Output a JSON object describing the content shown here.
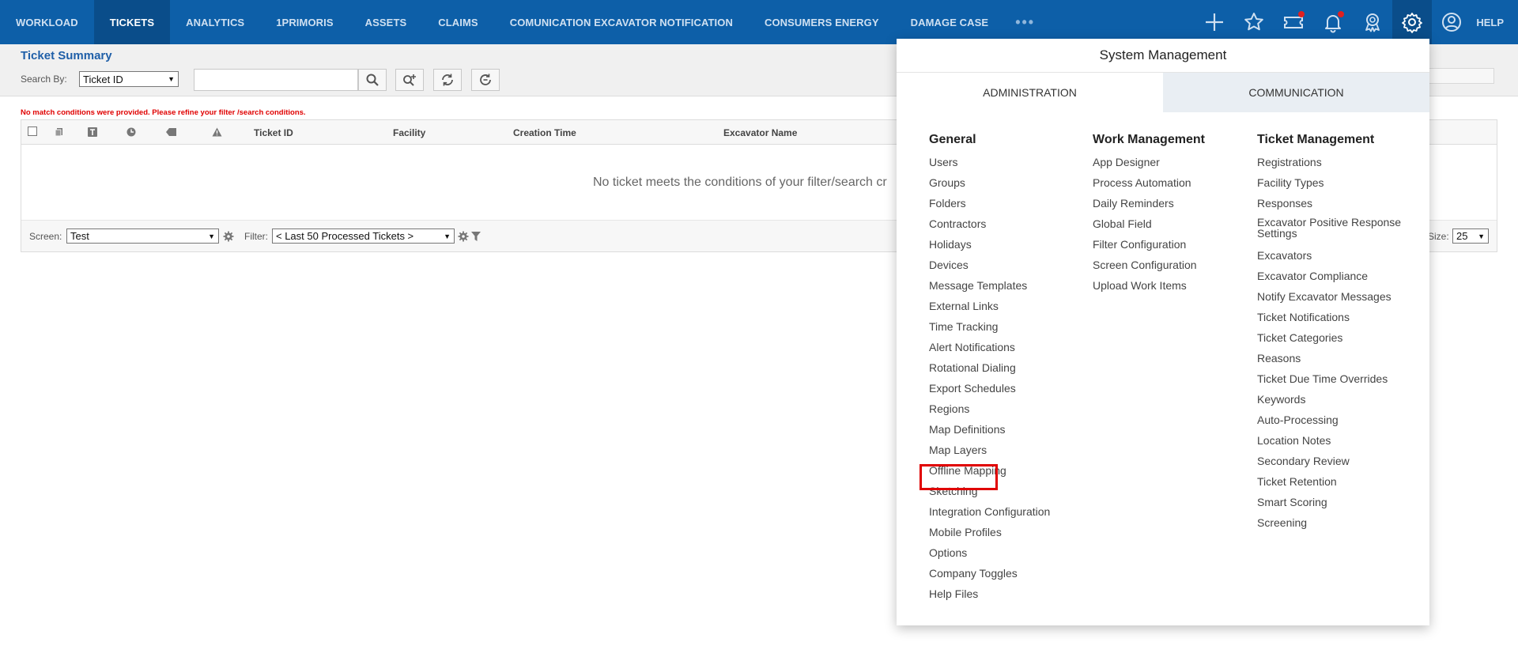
{
  "nav": {
    "tabs": [
      {
        "label": "WORKLOAD"
      },
      {
        "label": "TICKETS"
      },
      {
        "label": "ANALYTICS"
      },
      {
        "label": "1PRIMORIS"
      },
      {
        "label": "ASSETS"
      },
      {
        "label": "CLAIMS"
      },
      {
        "label": "COMUNICATION EXCAVATOR NOTIFICATION"
      },
      {
        "label": "CONSUMERS ENERGY"
      },
      {
        "label": "DAMAGE CASE"
      }
    ],
    "more_label": "•••",
    "active_tab": "TICKETS",
    "icons": [
      "plus-icon",
      "star-icon",
      "ticket-icon",
      "bell-icon",
      "award-icon",
      "gear-icon",
      "user-circle-icon"
    ],
    "help_label": "HELP"
  },
  "summary": {
    "title": "Ticket Summary",
    "search_by_label": "Search By:",
    "search_by_value": "Ticket ID",
    "search_value": "",
    "error": "No match conditions were provided. Please refine your filter /search conditions."
  },
  "grid": {
    "columns": [
      "Ticket ID",
      "Facility",
      "Creation Time",
      "Excavator Name"
    ],
    "empty_text": "No ticket meets the conditions of your filter/search cr",
    "footer": {
      "screen_label": "Screen:",
      "screen_value": "Test",
      "filter_label": "Filter:",
      "filter_value": "< Last 50 Processed Tickets >",
      "page_size_label": "Size:",
      "page_size_value": "25"
    }
  },
  "system_management": {
    "title": "System Management",
    "tabs": [
      {
        "label": "ADMINISTRATION"
      },
      {
        "label": "COMMUNICATION"
      }
    ],
    "active_tab": "ADMINISTRATION",
    "columns": [
      {
        "heading": "General",
        "items": [
          "Users",
          "Groups",
          "Folders",
          "Contractors",
          "Holidays",
          "Devices",
          "Message Templates",
          "External Links",
          "Time Tracking",
          "Alert Notifications",
          "Rotational Dialing",
          "Export Schedules",
          "Regions",
          "Map Definitions",
          "Map Layers",
          "Offline Mapping",
          "Sketching",
          "Integration Configuration",
          "Mobile Profiles",
          "Options",
          "Company Toggles",
          "Help Files"
        ]
      },
      {
        "heading": "Work Management",
        "items": [
          "App Designer",
          "Process Automation",
          "Daily Reminders",
          "Global Field",
          "Filter Configuration",
          "Screen Configuration",
          "Upload Work Items"
        ]
      },
      {
        "heading": "Ticket Management",
        "items": [
          "Registrations",
          "Facility Types",
          "Responses",
          "Excavator Positive Response Settings",
          "Excavators",
          "Excavator Compliance",
          "Notify Excavator Messages",
          "Ticket Notifications",
          "Ticket Categories",
          "Reasons",
          "Ticket Due Time Overrides",
          "Keywords",
          "Auto-Processing",
          "Location Notes",
          "Secondary Review",
          "Ticket Retention",
          "Smart Scoring",
          "Screening"
        ]
      }
    ],
    "highlighted_item": "Map Layers",
    "colors": {
      "highlight": "#e00000",
      "nav_bg": "#0d5fa8",
      "title_blue": "#1f5fa8"
    }
  }
}
